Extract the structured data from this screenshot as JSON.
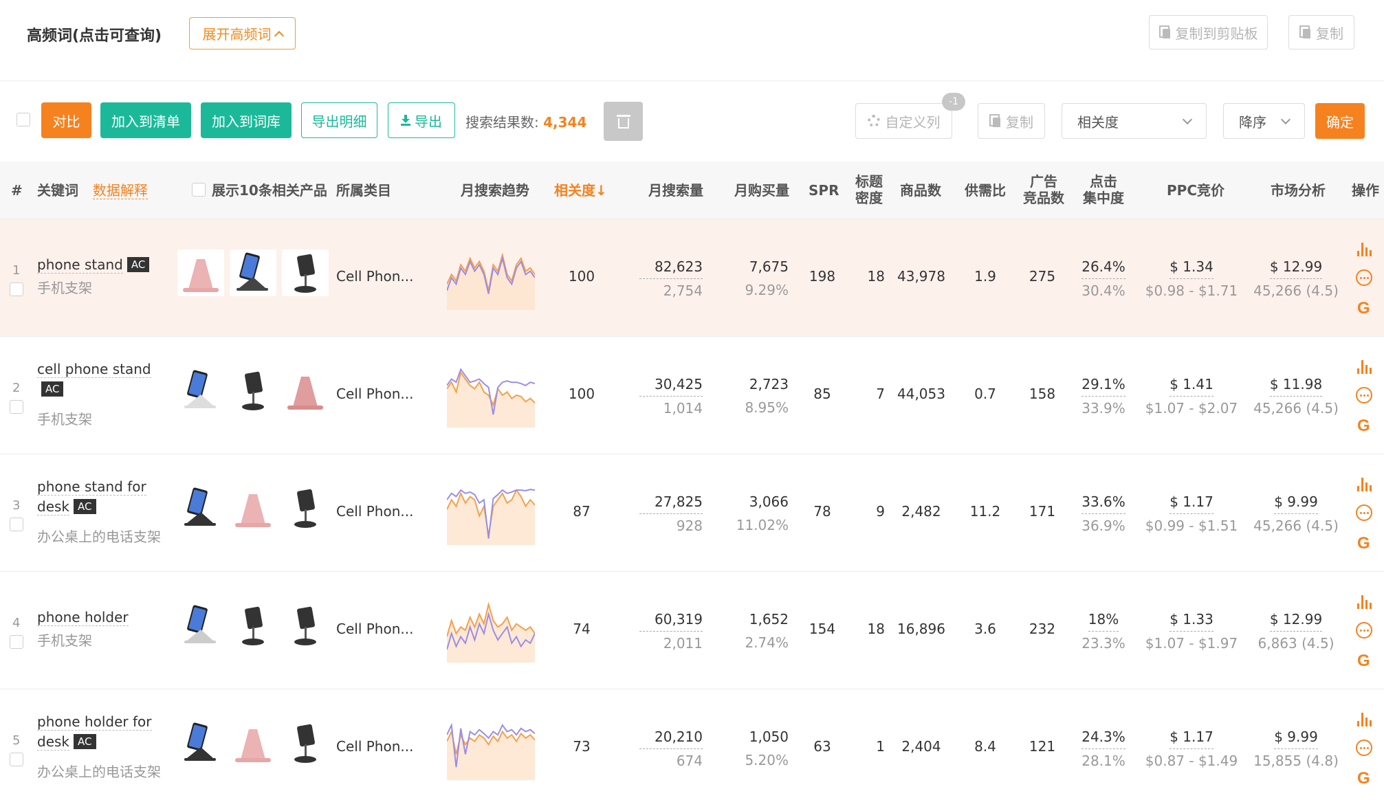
{
  "topbar": {
    "title": "高频词(点击可查询)",
    "expand_label": "展开高频词",
    "copy_clipboard_label": "复制到剪贴板",
    "copy_label": "复制"
  },
  "toolbar": {
    "compare_label": "对比",
    "add_list_label": "加入到清单",
    "add_lib_label": "加入到词库",
    "export_detail_label": "导出明细",
    "export_label": "导出",
    "result_label": "搜索结果数:",
    "result_count": "4,344",
    "custom_cols_label": "自定义列",
    "custom_cols_badge": "-1",
    "copy_label": "复制",
    "sort_field": "相关度",
    "sort_order": "降序",
    "confirm_label": "确定"
  },
  "colors": {
    "accent": "#f5821f",
    "teal": "#1bb99a",
    "active_row": "#fdf1ec"
  },
  "headers": {
    "num": "#",
    "keyword": "关键词",
    "data_explain": "数据解释",
    "show_products": "展示10条相关产品",
    "category": "所属类目",
    "trend": "月搜索趋势",
    "relevance": "相关度↓",
    "monthly_search": "月搜索量",
    "monthly_buy": "月购买量",
    "spr": "SPR",
    "title_density_1": "标题",
    "title_density_2": "密度",
    "product_count": "商品数",
    "supply_ratio": "供需比",
    "ad_count_1": "广告",
    "ad_count_2": "竞品数",
    "click_conc_1": "点击",
    "click_conc_2": "集中度",
    "ppc": "PPC竞价",
    "market": "市场分析",
    "ops": "操作"
  },
  "rows": [
    {
      "num": "1",
      "keyword": "phone stand",
      "ac": "AC",
      "cn": "手机支架",
      "category": "Cell Phon...",
      "relevance": "100",
      "search": "82,623",
      "search_sub": "2,754",
      "buy": "7,675",
      "buy_sub": "9.29%",
      "spr": "198",
      "title_density": "18",
      "products": "43,978",
      "supply": "1.9",
      "ads": "275",
      "click": "26.4%",
      "click_sub": "30.4%",
      "ppc": "$ 1.34",
      "ppc_range": "$0.98 - $1.71",
      "market": "$ 12.99",
      "market_sub": "45,266 (4.5)",
      "trend_a": [
        40,
        55,
        45,
        70,
        60,
        80,
        65,
        75,
        60,
        30,
        70,
        60,
        85,
        55,
        45,
        70,
        80,
        60,
        65,
        55
      ],
      "trend_b": [
        30,
        50,
        40,
        65,
        55,
        75,
        60,
        70,
        55,
        25,
        65,
        55,
        80,
        50,
        40,
        65,
        75,
        55,
        60,
        50
      ]
    },
    {
      "num": "2",
      "keyword": "cell phone stand",
      "ac": "AC",
      "cn": "手机支架",
      "category": "Cell Phon...",
      "relevance": "100",
      "search": "30,425",
      "search_sub": "1,014",
      "buy": "2,723",
      "buy_sub": "8.95%",
      "spr": "85",
      "title_density": "7",
      "products": "44,053",
      "supply": "0.7",
      "ads": "158",
      "click": "29.1%",
      "click_sub": "33.9%",
      "ppc": "$ 1.41",
      "ppc_range": "$1.07 - $2.07",
      "market": "$ 11.98",
      "market_sub": "45,266 (4.5)",
      "trend_a": [
        60,
        70,
        55,
        85,
        75,
        65,
        60,
        70,
        55,
        50,
        35,
        60,
        50,
        55,
        45,
        50,
        48,
        40,
        45,
        38
      ],
      "trend_b": [
        65,
        75,
        70,
        90,
        80,
        70,
        72,
        75,
        68,
        62,
        20,
        62,
        70,
        72,
        70,
        70,
        68,
        65,
        70,
        68
      ]
    },
    {
      "num": "3",
      "keyword": "phone stand for desk",
      "ac": "AC",
      "cn": "办公桌上的电话支架",
      "category": "Cell Phon...",
      "relevance": "87",
      "search": "27,825",
      "search_sub": "928",
      "buy": "3,066",
      "buy_sub": "11.02%",
      "spr": "78",
      "title_density": "9",
      "products": "2,482",
      "supply": "11.2",
      "ads": "171",
      "click": "33.6%",
      "click_sub": "36.9%",
      "ppc": "$ 1.17",
      "ppc_range": "$0.99 - $1.51",
      "market": "$ 9.99",
      "market_sub": "45,266 (4.5)",
      "trend_a": [
        55,
        70,
        60,
        80,
        65,
        75,
        70,
        45,
        60,
        15,
        60,
        70,
        80,
        65,
        70,
        85,
        75,
        60,
        70,
        62
      ],
      "trend_b": [
        70,
        80,
        75,
        85,
        80,
        82,
        78,
        65,
        70,
        10,
        72,
        78,
        85,
        80,
        82,
        85,
        85,
        84,
        86,
        85
      ]
    },
    {
      "num": "4",
      "keyword": "phone holder",
      "ac": "",
      "cn": "手机支架",
      "category": "Cell Phon...",
      "relevance": "74",
      "search": "60,319",
      "search_sub": "2,011",
      "buy": "1,652",
      "buy_sub": "2.74%",
      "spr": "154",
      "title_density": "18",
      "products": "16,896",
      "supply": "3.6",
      "ads": "232",
      "click": "18%",
      "click_sub": "23.3%",
      "ppc": "$ 1.33",
      "ppc_range": "$1.07 - $1.97",
      "market": "$ 12.99",
      "market_sub": "6,863 (4.5)",
      "trend_a": [
        40,
        65,
        45,
        55,
        50,
        70,
        55,
        75,
        60,
        90,
        65,
        55,
        60,
        70,
        50,
        60,
        55,
        50,
        55,
        45
      ],
      "trend_b": [
        20,
        45,
        25,
        40,
        30,
        55,
        35,
        60,
        45,
        75,
        50,
        35,
        45,
        55,
        30,
        40,
        25,
        35,
        30,
        45
      ]
    },
    {
      "num": "5",
      "keyword": "phone holder for desk",
      "ac": "AC",
      "cn": "办公桌上的电话支架",
      "category": "Cell Phon...",
      "relevance": "73",
      "search": "20,210",
      "search_sub": "674",
      "buy": "1,050",
      "buy_sub": "5.20%",
      "spr": "63",
      "title_density": "1",
      "products": "2,404",
      "supply": "8.4",
      "ads": "121",
      "click": "24.3%",
      "click_sub": "28.1%",
      "ppc": "$ 1.17",
      "ppc_range": "$0.87 - $1.49",
      "market": "$ 9.99",
      "market_sub": "15,855 (4.8)",
      "trend_a": [
        60,
        75,
        40,
        70,
        55,
        65,
        60,
        70,
        65,
        55,
        68,
        60,
        75,
        65,
        70,
        60,
        72,
        65,
        70,
        62
      ],
      "trend_b": [
        70,
        85,
        20,
        80,
        40,
        75,
        70,
        78,
        72,
        65,
        75,
        70,
        85,
        75,
        78,
        70,
        80,
        75,
        78,
        72
      ]
    }
  ]
}
